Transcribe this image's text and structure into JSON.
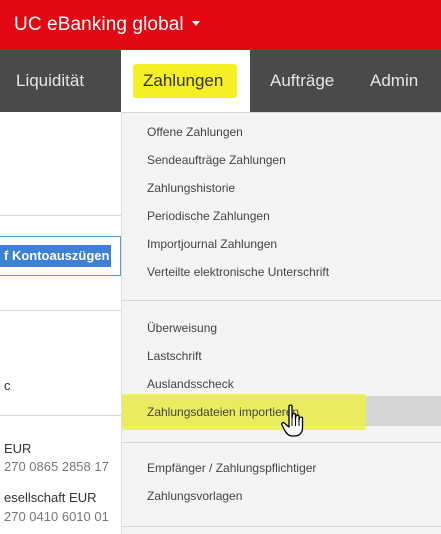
{
  "header": {
    "app_title": "UC eBanking global"
  },
  "nav": {
    "liquiditaet": "Liquidität",
    "zahlungen": "Zahlungen",
    "auftraege": "Aufträge",
    "admin": "Admin"
  },
  "background": {
    "search_selection": "f Kontoauszügen",
    "row1": "c",
    "row2_name": "EUR",
    "row2_iban": "270 0865 2858 17",
    "row3_name": "esellschaft EUR",
    "row3_iban": "270 0410 6010 01"
  },
  "menu": {
    "group1": [
      "Offene Zahlungen",
      "Sendeaufträge Zahlungen",
      "Zahlungshistorie",
      "Periodische Zahlungen",
      "Importjournal Zahlungen",
      "Verteilte elektronische Unterschrift"
    ],
    "group2": [
      "Überweisung",
      "Lastschrift",
      "Auslandsscheck",
      "Zahlungsdateien importieren"
    ],
    "group3": [
      "Empfänger / Zahlungspflichtiger",
      "Zahlungsvorlagen"
    ]
  },
  "colors": {
    "brand_red": "#e30613",
    "nav_gray": "#4a4a4a",
    "highlight_yellow": "#f5ef24"
  },
  "icons": {
    "cursor": "hand-pointer-icon"
  }
}
